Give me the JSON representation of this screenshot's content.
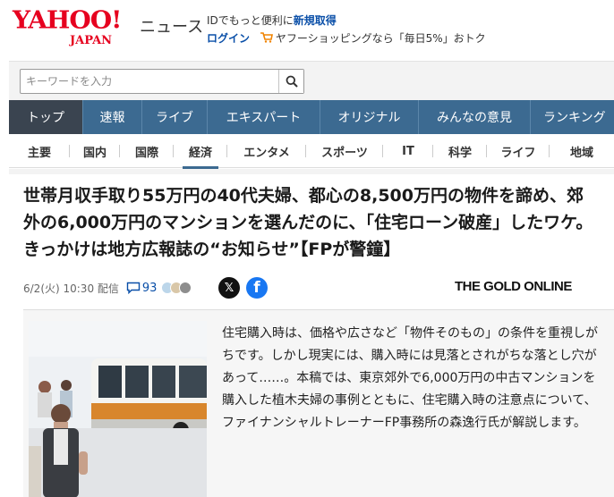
{
  "header": {
    "logo_text": "YAHOO!",
    "logo_sub": "JAPAN",
    "section_label": "ニュース",
    "promo_line1_text": "IDでもっと便利に",
    "promo_line1_link": "新規取得",
    "login_label": "ログイン",
    "promo_line2_text": "ヤフーショッピングなら「毎日5%」おトク"
  },
  "search": {
    "placeholder": "キーワードを入力"
  },
  "main_nav": {
    "items": [
      "トップ",
      "速報",
      "ライブ",
      "エキスパート",
      "オリジナル",
      "みんなの意見",
      "ランキング"
    ]
  },
  "sub_nav": {
    "items": [
      "主要",
      "国内",
      "国際",
      "経済",
      "エンタメ",
      "スポーツ",
      "IT",
      "科学",
      "ライフ",
      "地域"
    ]
  },
  "article": {
    "headline": "世帯月収手取り55万円の40代夫婦、都心の8,500万円の物件を諦め、郊外の6,000万円のマンションを選んだのに、「住宅ローン破産」したワケ。きっかけは地方広報誌の“お知らせ”【FPが警鐘】",
    "date": "6/2(火) 10:30 配信",
    "comment_count": "93",
    "publisher": "THE GOLD ONLINE",
    "lead": "住宅購入時は、価格や広さなど「物件そのもの」の条件を重視しがちです。しかし現実には、購入時には見落とされがちな落とし穴があって……。本稿では、東京郊外で6,000万円の中古マンションを購入した植木夫婦の事例とともに、住宅購入時の注意点について、ファイナンシャルトレーナーFP事務所の森逸行氏が解説します。"
  },
  "icons": {
    "search": "search-icon",
    "cart": "cart-icon",
    "comment": "comment-icon",
    "x_share": "x-share-icon",
    "facebook_share": "facebook-share-icon"
  },
  "colors": {
    "brand_red": "#e6001f",
    "nav_blue": "#3c6a91",
    "nav_active": "#3a4450",
    "link_blue": "#0a4fa8",
    "facebook": "#1877f2"
  }
}
